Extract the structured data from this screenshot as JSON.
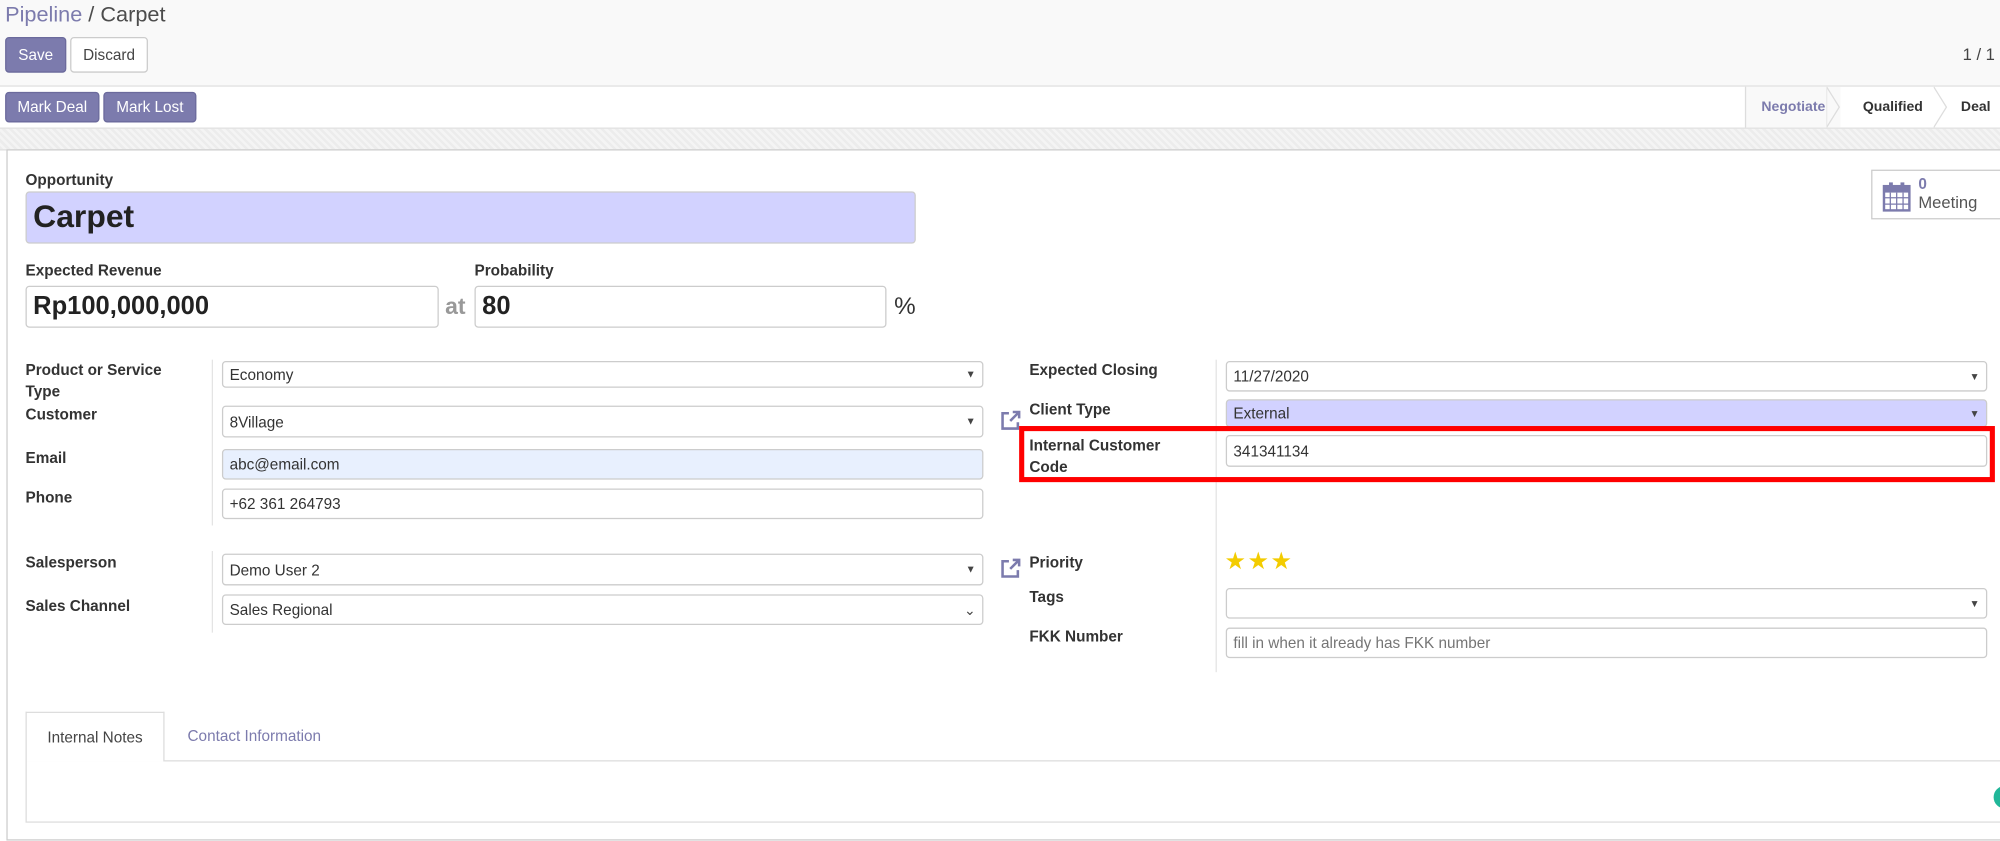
{
  "breadcrumb": {
    "parent": "Pipeline",
    "separator": "/",
    "current": "Carpet"
  },
  "toolbar": {
    "save_label": "Save",
    "discard_label": "Discard",
    "pager": "1 / 1"
  },
  "statusbar": {
    "mark_deal_label": "Mark Deal",
    "mark_lost_label": "Mark Lost",
    "stages": [
      {
        "label": "Negotiate",
        "active": true
      },
      {
        "label": "Qualified",
        "active": false
      },
      {
        "label": "Deal",
        "active": false
      }
    ]
  },
  "smart_button": {
    "count": "0",
    "label": "Meeting",
    "icon": "calendar-icon"
  },
  "opportunity": {
    "label": "Opportunity",
    "value": "Carpet"
  },
  "revenue": {
    "label": "Expected Revenue",
    "value": "Rp100,000,000",
    "at": "at"
  },
  "probability": {
    "label": "Probability",
    "value": "80",
    "unit": "%"
  },
  "left": {
    "product": {
      "label": "Product or Service Type",
      "value": "Economy"
    },
    "customer": {
      "label": "Customer",
      "value": "8Village"
    },
    "email": {
      "label": "Email",
      "value": "abc@email.com"
    },
    "phone": {
      "label": "Phone",
      "value": "+62 361 264793"
    },
    "salesperson": {
      "label": "Salesperson",
      "value": "Demo User 2"
    },
    "sales_channel": {
      "label": "Sales Channel",
      "value": "Sales Regional"
    }
  },
  "right": {
    "expected_closing": {
      "label": "Expected Closing",
      "value": "11/27/2020"
    },
    "client_type": {
      "label": "Client Type",
      "value": "External"
    },
    "internal_code": {
      "label": "Internal Customer Code",
      "value": "341341134"
    },
    "priority": {
      "label": "Priority",
      "stars_filled": 3,
      "stars_total": 3
    },
    "tags": {
      "label": "Tags",
      "value": ""
    },
    "fkk": {
      "label": "FKK Number",
      "value": "",
      "placeholder": "fill in when it already has FKK number"
    }
  },
  "tabs": [
    {
      "label": "Internal Notes",
      "active": true
    },
    {
      "label": "Contact Information",
      "active": false
    }
  ],
  "colors": {
    "brand": "#7c7bad",
    "required_bg": "#d2d2ff",
    "highlight_box": "#ff0000",
    "star": "#f3cc00"
  }
}
